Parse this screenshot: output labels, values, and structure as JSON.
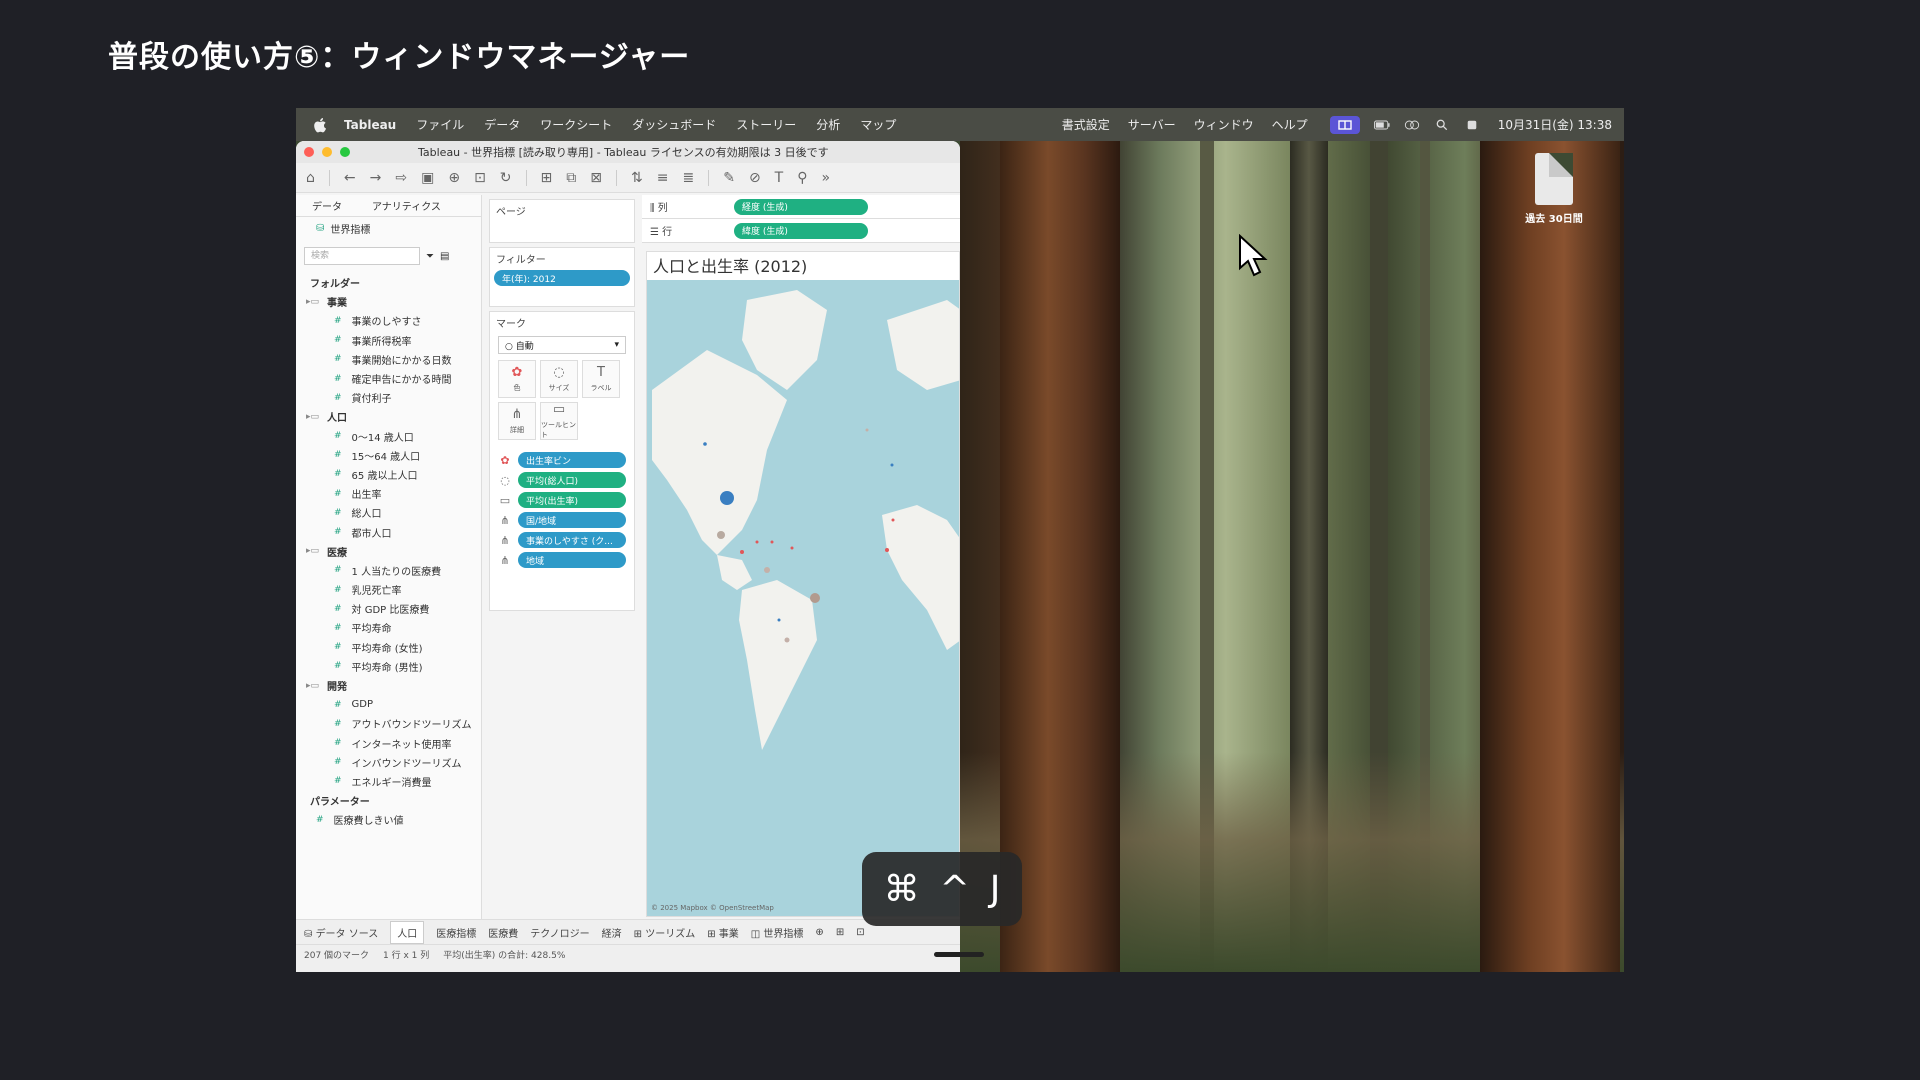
{
  "slide_title": "普段の使い方⑤：ウィンドウマネージャー",
  "menubar": {
    "app": "Tableau",
    "items": [
      "ファイル",
      "データ",
      "ワークシート",
      "ダッシュボード",
      "ストーリー",
      "分析",
      "マップ"
    ],
    "right_items": [
      "書式設定",
      "サーバー",
      "ウィンドウ",
      "ヘルプ"
    ],
    "clock": "10月31日(金) 13:38"
  },
  "window": {
    "title": "Tableau - 世界指標 [読み取り専用] - Tableau ライセンスの有効期限は 3 日後です"
  },
  "sidebar": {
    "tabs": [
      "データ",
      "アナリティクス"
    ],
    "datasource": "世界指標",
    "search_placeholder": "検索",
    "folders_header": "フォルダー",
    "groups": [
      {
        "name": "事業",
        "fields": [
          "事業のしやすさ",
          "事業所得税率",
          "事業開始にかかる日数",
          "確定申告にかかる時間",
          "貸付利子"
        ]
      },
      {
        "name": "人口",
        "fields": [
          "0～14 歳人口",
          "15～64 歳人口",
          "65 歳以上人口",
          "出生率",
          "総人口",
          "都市人口"
        ]
      },
      {
        "name": "医療",
        "fields": [
          "1 人当たりの医療費",
          "乳児死亡率",
          "対 GDP 比医療費",
          "平均寿命",
          "平均寿命 (女性)",
          "平均寿命 (男性)"
        ]
      },
      {
        "name": "開発",
        "fields": [
          "GDP",
          "アウトバウンドツーリズム",
          "インターネット使用率",
          "インバウンドツーリズム",
          "エネルギー消費量"
        ]
      }
    ],
    "params_header": "パラメーター",
    "params": [
      "医療費しきい値"
    ]
  },
  "shelves": {
    "pages_label": "ページ",
    "filters_label": "フィルター",
    "filter_pill": "年(年): 2012",
    "marks_label": "マーク",
    "marks_type": "自動",
    "mark_buttons": [
      {
        "icon": "✿",
        "label": "色"
      },
      {
        "icon": "◌",
        "label": "サイズ"
      },
      {
        "icon": "T",
        "label": "ラベル"
      },
      {
        "icon": "⋔",
        "label": "詳細"
      },
      {
        "icon": "▭",
        "label": "ツールヒント"
      }
    ],
    "mark_pills": [
      {
        "icon": "✿",
        "label": "出生率ビン",
        "color": "blue"
      },
      {
        "icon": "◌",
        "label": "平均(総人口)",
        "color": "green"
      },
      {
        "icon": "▭",
        "label": "平均(出生率)",
        "color": "green"
      },
      {
        "icon": "⋔",
        "label": "国/地域",
        "color": "blue"
      },
      {
        "icon": "⋔",
        "label": "事業のしやすさ (ク...",
        "color": "blue"
      },
      {
        "icon": "⋔",
        "label": "地域",
        "color": "blue"
      }
    ]
  },
  "canvas": {
    "columns_label": "列",
    "columns_pill": "経度 (生成)",
    "rows_label": "行",
    "rows_pill": "緯度 (生成)",
    "viz_title": "人口と出生率 (2012)",
    "attribution": "© 2025 Mapbox © OpenStreetMap"
  },
  "bottom": {
    "datasource_tab": "データ ソース",
    "sheets": [
      "人口",
      "医療指標",
      "医療費",
      "テクノロジー",
      "経済",
      "ツーリズム",
      "事業",
      "世界指標"
    ],
    "status": [
      "207 個のマーク",
      "1 行 x 1 列",
      "平均(出生率) の合計: 428.5%"
    ]
  },
  "desktop": {
    "file_label": "過去 30日間"
  },
  "shortcut": {
    "keys": [
      "⌘",
      "^",
      "J"
    ]
  },
  "colors": {
    "pill_blue": "#2e9ac8",
    "pill_green": "#1fb082",
    "menu_accent": "#5b55d6"
  }
}
